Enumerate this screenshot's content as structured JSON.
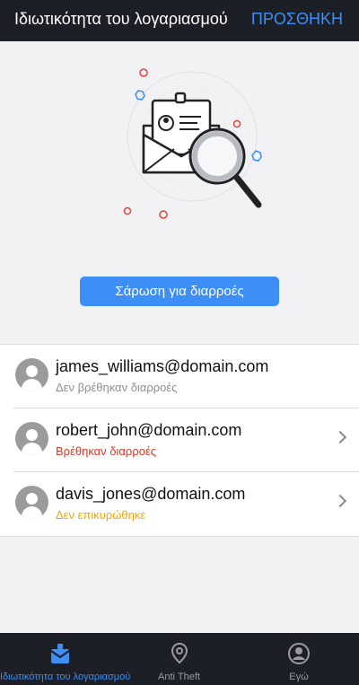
{
  "header": {
    "title": "Ιδιωτικότητα του λογαριασμού",
    "add_label": "ΠΡΟΣΘΗΚΗ"
  },
  "illustration": {
    "icon": "envelope-magnifier-icon"
  },
  "scan_button": {
    "label": "Σάρωση για διαρροές"
  },
  "accounts": [
    {
      "email": "james_williams@domain.com",
      "status": "Δεν βρέθηκαν διαρροές",
      "status_color": "#8e8e93",
      "has_chevron": false
    },
    {
      "email": "robert_john@domain.com",
      "status": "Βρέθηκαν διαρροές",
      "status_color": "#d13b2b",
      "has_chevron": true
    },
    {
      "email": "davis_jones@domain.com",
      "status": "Δεν επικυρώθηκε",
      "status_color": "#f0a800",
      "has_chevron": true
    }
  ],
  "tabbar": {
    "tabs": [
      {
        "label": "Ιδιωτικότητα του λογαριασμού",
        "icon": "account-privacy-icon",
        "active": true
      },
      {
        "label": "Anti Theft",
        "icon": "location-pin-icon",
        "active": false
      },
      {
        "label": "Εγώ",
        "icon": "profile-icon",
        "active": false
      }
    ]
  },
  "colors": {
    "accent": "#3d8ef5",
    "bar": "#1c1f26",
    "background": "#f2f2f4"
  }
}
